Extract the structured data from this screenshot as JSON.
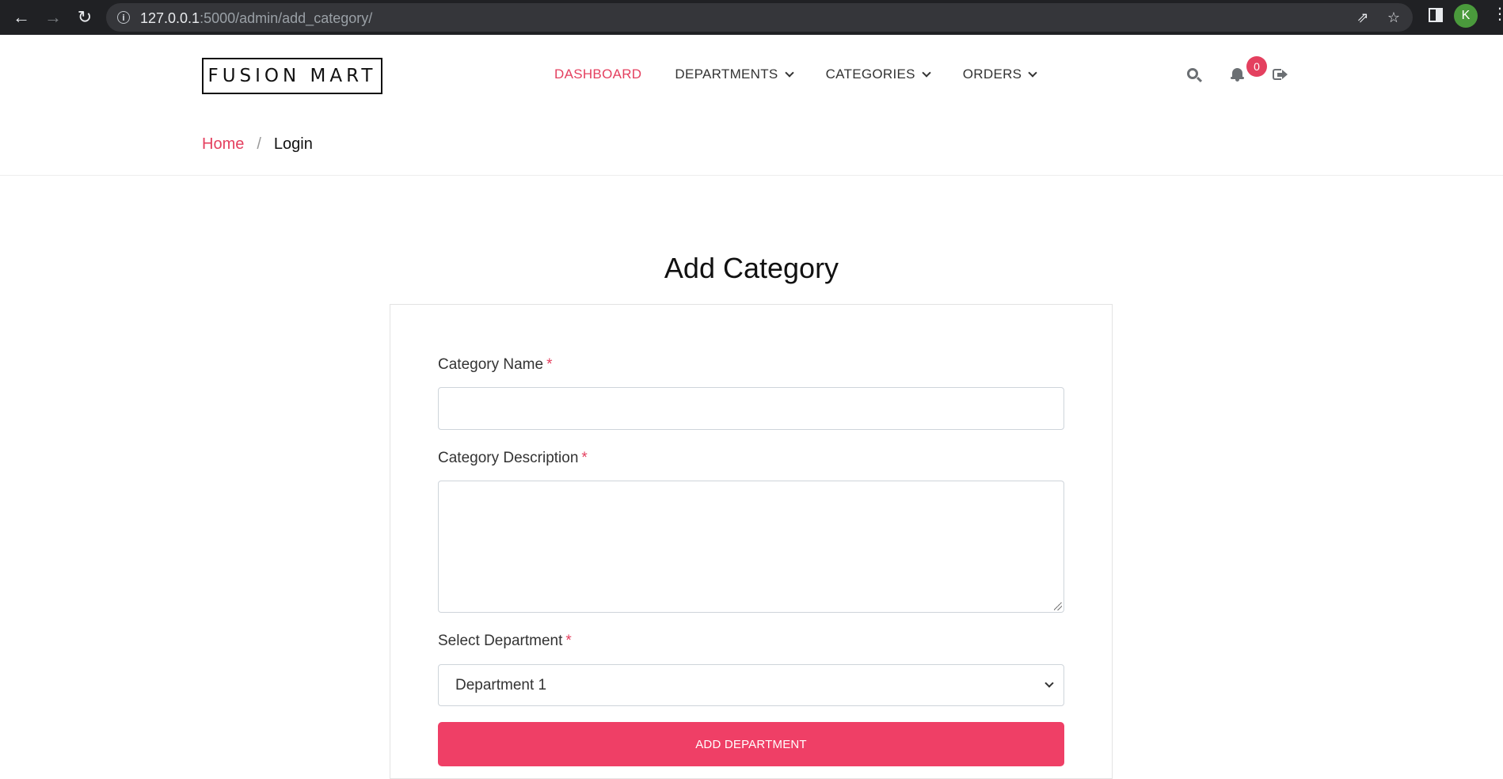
{
  "browser": {
    "url_host": "127.0.0.1",
    "url_path": ":5000/admin/add_category/",
    "profile_initial": "K"
  },
  "site": {
    "logo": "FUSION MART",
    "nav": [
      {
        "label": "DASHBOARD",
        "active": true
      },
      {
        "label": "DEPARTMENTS",
        "active": false
      },
      {
        "label": "CATEGORIES",
        "active": false
      },
      {
        "label": "ORDERS",
        "active": false
      }
    ],
    "notification_count": "0",
    "accent_color": "#e4405f"
  },
  "breadcrumb": {
    "home": "Home",
    "separator": "/",
    "current": "Login"
  },
  "form": {
    "title": "Add Category",
    "name_label": "Category Name",
    "name_value": "",
    "description_label": "Category Description",
    "description_value": "",
    "department_label": "Select Department",
    "department_selected": "Department 1",
    "required_mark": "*",
    "submit_label": "ADD DEPARTMENT",
    "submit_color": "#ef3f66"
  },
  "icons": [
    "back-arrow-icon",
    "forward-arrow-icon",
    "reload-icon",
    "info-icon",
    "share-icon",
    "star-icon",
    "side-panel-icon",
    "kebab-menu-icon",
    "search-icon",
    "bell-icon",
    "logout-icon",
    "chevron-down-icon"
  ]
}
